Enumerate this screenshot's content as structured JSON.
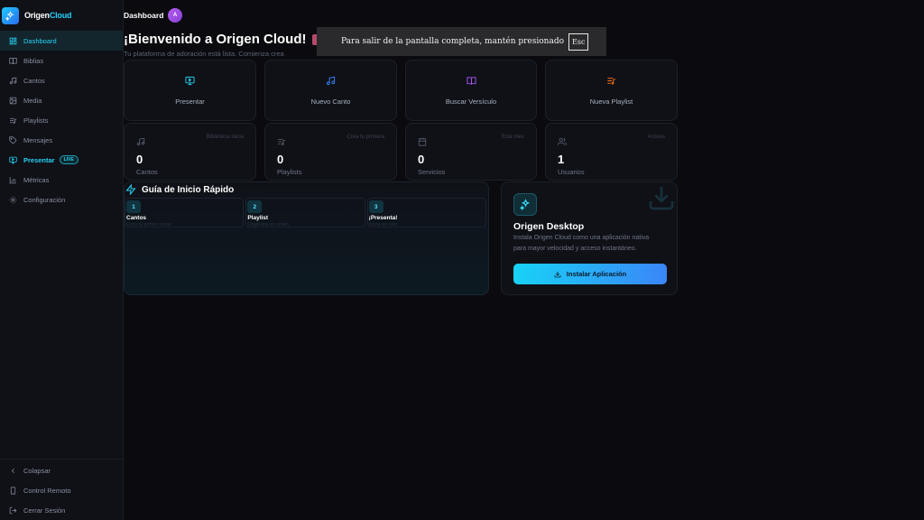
{
  "brand": {
    "name_part1": "Origen",
    "name_part2": "Cloud"
  },
  "sidebar": {
    "items": [
      {
        "label": "Dashboard",
        "icon": "grid-icon"
      },
      {
        "label": "Biblias",
        "icon": "book-icon"
      },
      {
        "label": "Cantos",
        "icon": "music-note-icon"
      },
      {
        "label": "Media",
        "icon": "image-icon"
      },
      {
        "label": "Playlists",
        "icon": "playlist-icon"
      },
      {
        "label": "Mensajes",
        "icon": "tag-icon"
      },
      {
        "label": "Presentar",
        "icon": "monitor-icon",
        "badge": "LIVE"
      },
      {
        "label": "Métricas",
        "icon": "bar-chart-icon"
      },
      {
        "label": "Configuración",
        "icon": "gear-icon"
      }
    ],
    "bottom": [
      {
        "label": "Colapsar",
        "icon": "chevron-left-icon"
      },
      {
        "label": "Control Remoto",
        "icon": "phone-icon"
      },
      {
        "label": "Cerrar Sesión",
        "icon": "logout-icon"
      }
    ]
  },
  "header": {
    "title": "Dashboard",
    "avatar_initial": "A"
  },
  "welcome": {
    "title": "¡Bienvenido a Origen Cloud! ",
    "subtitle": "Tu plataforma de adoración está lista. Comienza crea"
  },
  "toast": {
    "text": "Para salir de la pantalla completa, mantén presionado",
    "key": "Esc"
  },
  "actions": [
    {
      "label": "Presentar",
      "icon": "monitor-icon",
      "color": "#27d3f5"
    },
    {
      "label": "Nuevo Canto",
      "icon": "music-note-icon",
      "color": "#3b82f6"
    },
    {
      "label": "Buscar Versículo",
      "icon": "book-icon",
      "color": "#a855f7"
    },
    {
      "label": "Nueva Playlist",
      "icon": "playlist-icon",
      "color": "#f97316"
    }
  ],
  "stats": [
    {
      "value": "0",
      "label": "Cantos",
      "hint": "Biblioteca inicia",
      "icon": "music-note-icon"
    },
    {
      "value": "0",
      "label": "Playlists",
      "hint": "Crea tu primera",
      "icon": "playlist-icon"
    },
    {
      "value": "0",
      "label": "Servicios",
      "hint": "Este mes",
      "icon": "calendar-icon"
    },
    {
      "value": "1",
      "label": "Usuarios",
      "hint": "Activos",
      "icon": "users-icon"
    }
  ],
  "guide": {
    "title": "Guía de Inicio Rápido",
    "steps": [
      {
        "num": "1",
        "name": "Cantos",
        "desc": "Crea tu primer canto"
      },
      {
        "num": "2",
        "name": "Playlist",
        "desc": "Organiza un orden"
      },
      {
        "num": "3",
        "name": "¡Presenta!",
        "desc": "Inicia en vivo"
      }
    ]
  },
  "desktop": {
    "title": "Origen Desktop",
    "desc": "Instala Origen Cloud como una aplicación nativa para mayor velocidad y acceso instantáneo.",
    "button": "Instalar Aplicación"
  },
  "colors": {
    "accent": "#27d3f5",
    "background": "#0b0b0f",
    "card": "#0f1117"
  }
}
